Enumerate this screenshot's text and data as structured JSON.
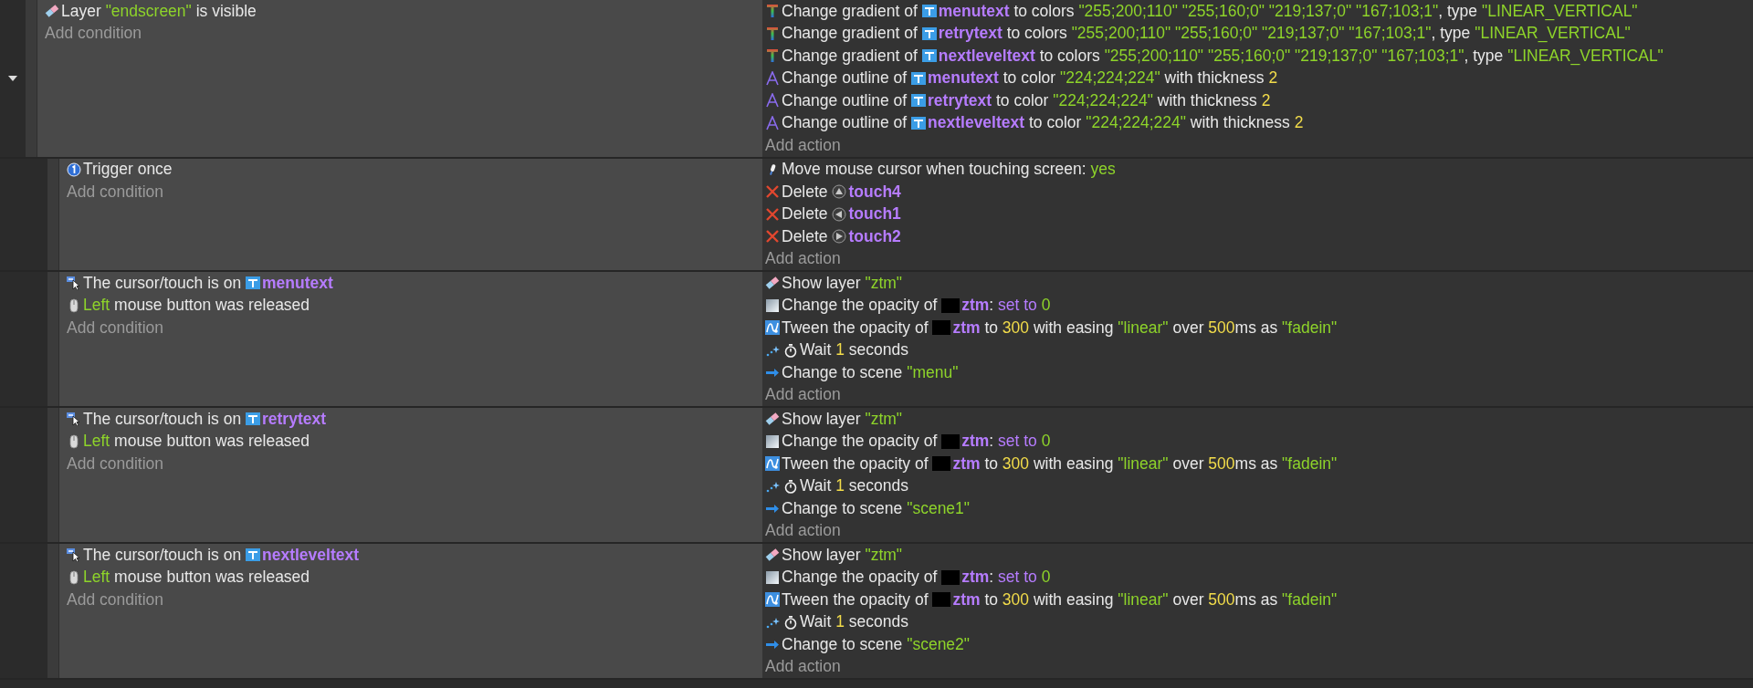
{
  "events": [
    {
      "expanded": true,
      "add_condition": "Add condition",
      "add_action": "Add action",
      "conditions": [
        {
          "kind": "layer",
          "parts": [
            {
              "kind": "plain",
              "text": "Layer "
            },
            {
              "kind": "string",
              "text": "\"endscreen\""
            },
            {
              "kind": "plain",
              "text": " is visible"
            }
          ]
        }
      ],
      "actions": [
        {
          "kind": "gradient",
          "parts": [
            {
              "kind": "plain",
              "text": "Change gradient of "
            },
            {
              "kind": "text-object",
              "text": "menutext"
            },
            {
              "kind": "plain",
              "text": " to colors "
            },
            {
              "kind": "string",
              "text": "\"255;200;110\" \"255;160;0\" \"219;137;0\" \"167;103;1\""
            },
            {
              "kind": "plain",
              "text": ", type "
            },
            {
              "kind": "string",
              "text": "\"LINEAR_VERTICAL\""
            }
          ]
        },
        {
          "kind": "gradient",
          "parts": [
            {
              "kind": "plain",
              "text": "Change gradient of "
            },
            {
              "kind": "text-object",
              "text": "retrytext"
            },
            {
              "kind": "plain",
              "text": " to colors "
            },
            {
              "kind": "string",
              "text": "\"255;200;110\" \"255;160;0\" \"219;137;0\" \"167;103;1\""
            },
            {
              "kind": "plain",
              "text": ", type "
            },
            {
              "kind": "string",
              "text": "\"LINEAR_VERTICAL\""
            }
          ]
        },
        {
          "kind": "gradient",
          "parts": [
            {
              "kind": "plain",
              "text": "Change gradient of "
            },
            {
              "kind": "text-object",
              "text": "nextleveltext"
            },
            {
              "kind": "plain",
              "text": " to colors "
            },
            {
              "kind": "string",
              "text": "\"255;200;110\" \"255;160;0\" \"219;137;0\" \"167;103;1\""
            },
            {
              "kind": "plain",
              "text": ", type "
            },
            {
              "kind": "string",
              "text": "\"LINEAR_VERTICAL\""
            }
          ]
        },
        {
          "kind": "outline",
          "parts": [
            {
              "kind": "plain",
              "text": "Change outline of "
            },
            {
              "kind": "text-object",
              "text": "menutext"
            },
            {
              "kind": "plain",
              "text": " to color "
            },
            {
              "kind": "string",
              "text": "\"224;224;224\""
            },
            {
              "kind": "plain",
              "text": " with thickness "
            },
            {
              "kind": "number",
              "text": "2"
            }
          ]
        },
        {
          "kind": "outline",
          "parts": [
            {
              "kind": "plain",
              "text": "Change outline of "
            },
            {
              "kind": "text-object",
              "text": "retrytext"
            },
            {
              "kind": "plain",
              "text": " to color "
            },
            {
              "kind": "string",
              "text": "\"224;224;224\""
            },
            {
              "kind": "plain",
              "text": " with thickness "
            },
            {
              "kind": "number",
              "text": "2"
            }
          ]
        },
        {
          "kind": "outline",
          "parts": [
            {
              "kind": "plain",
              "text": "Change outline of "
            },
            {
              "kind": "text-object",
              "text": "nextleveltext"
            },
            {
              "kind": "plain",
              "text": " to color "
            },
            {
              "kind": "string",
              "text": "\"224;224;224\""
            },
            {
              "kind": "plain",
              "text": " with thickness "
            },
            {
              "kind": "number",
              "text": "2"
            }
          ]
        }
      ],
      "children": [
        {
          "add_condition": "Add condition",
          "add_action": "Add action",
          "conditions": [
            {
              "kind": "trigger",
              "parts": [
                {
                  "kind": "plain",
                  "text": "Trigger once"
                }
              ]
            }
          ],
          "actions": [
            {
              "kind": "touch",
              "parts": [
                {
                  "kind": "plain",
                  "text": "Move mouse cursor when touching screen: "
                },
                {
                  "kind": "string",
                  "text": "yes"
                }
              ]
            },
            {
              "kind": "delete",
              "parts": [
                {
                  "kind": "plain",
                  "text": "Delete "
                },
                {
                  "kind": "up-button",
                  "text": "touch4"
                }
              ]
            },
            {
              "kind": "delete",
              "parts": [
                {
                  "kind": "plain",
                  "text": "Delete "
                },
                {
                  "kind": "left-button",
                  "text": "touch1"
                }
              ]
            },
            {
              "kind": "delete",
              "parts": [
                {
                  "kind": "plain",
                  "text": "Delete "
                },
                {
                  "kind": "right-button",
                  "text": "touch2"
                }
              ]
            }
          ]
        },
        {
          "add_condition": "Add condition",
          "add_action": "Add action",
          "conditions": [
            {
              "kind": "cursor",
              "parts": [
                {
                  "kind": "plain",
                  "text": "The cursor/touch is on "
                },
                {
                  "kind": "text-object",
                  "text": "menutext"
                }
              ]
            },
            {
              "kind": "mouse",
              "parts": [
                {
                  "kind": "string",
                  "text": "Left"
                },
                {
                  "kind": "plain",
                  "text": " mouse button was released"
                }
              ]
            }
          ],
          "actions": [
            {
              "kind": "layer",
              "parts": [
                {
                  "kind": "plain",
                  "text": "Show layer "
                },
                {
                  "kind": "string",
                  "text": "\"ztm\""
                }
              ]
            },
            {
              "kind": "opacity",
              "parts": [
                {
                  "kind": "plain",
                  "text": "Change the opacity of "
                },
                {
                  "kind": "sprite-object",
                  "text": "ztm"
                },
                {
                  "kind": "plain",
                  "text": ": "
                },
                {
                  "kind": "param",
                  "text": "set to "
                },
                {
                  "kind": "string",
                  "text": "0"
                }
              ]
            },
            {
              "kind": "tween",
              "parts": [
                {
                  "kind": "plain",
                  "text": "Tween the opacity of "
                },
                {
                  "kind": "sprite-object",
                  "text": "ztm"
                },
                {
                  "kind": "plain",
                  "text": " to "
                },
                {
                  "kind": "number",
                  "text": "300"
                },
                {
                  "kind": "plain",
                  "text": " with easing "
                },
                {
                  "kind": "string",
                  "text": "\"linear\""
                },
                {
                  "kind": "plain",
                  "text": " over "
                },
                {
                  "kind": "number",
                  "text": "500"
                },
                {
                  "kind": "plain",
                  "text": "ms as "
                },
                {
                  "kind": "string",
                  "text": "\"fadein\""
                }
              ]
            },
            {
              "kind": "wait",
              "parts": [
                {
                  "kind": "plain",
                  "text": "Wait "
                },
                {
                  "kind": "number",
                  "text": "1"
                },
                {
                  "kind": "plain",
                  "text": " seconds"
                }
              ]
            },
            {
              "kind": "scene",
              "parts": [
                {
                  "kind": "plain",
                  "text": "Change to scene "
                },
                {
                  "kind": "string",
                  "text": "\"menu\""
                }
              ]
            }
          ]
        },
        {
          "add_condition": "Add condition",
          "add_action": "Add action",
          "conditions": [
            {
              "kind": "cursor",
              "parts": [
                {
                  "kind": "plain",
                  "text": "The cursor/touch is on "
                },
                {
                  "kind": "text-object",
                  "text": "retrytext"
                }
              ]
            },
            {
              "kind": "mouse",
              "parts": [
                {
                  "kind": "string",
                  "text": "Left"
                },
                {
                  "kind": "plain",
                  "text": " mouse button was released"
                }
              ]
            }
          ],
          "actions": [
            {
              "kind": "layer",
              "parts": [
                {
                  "kind": "plain",
                  "text": "Show layer "
                },
                {
                  "kind": "string",
                  "text": "\"ztm\""
                }
              ]
            },
            {
              "kind": "opacity",
              "parts": [
                {
                  "kind": "plain",
                  "text": "Change the opacity of "
                },
                {
                  "kind": "sprite-object",
                  "text": "ztm"
                },
                {
                  "kind": "plain",
                  "text": ": "
                },
                {
                  "kind": "param",
                  "text": "set to "
                },
                {
                  "kind": "string",
                  "text": "0"
                }
              ]
            },
            {
              "kind": "tween",
              "parts": [
                {
                  "kind": "plain",
                  "text": "Tween the opacity of "
                },
                {
                  "kind": "sprite-object",
                  "text": "ztm"
                },
                {
                  "kind": "plain",
                  "text": " to "
                },
                {
                  "kind": "number",
                  "text": "300"
                },
                {
                  "kind": "plain",
                  "text": " with easing "
                },
                {
                  "kind": "string",
                  "text": "\"linear\""
                },
                {
                  "kind": "plain",
                  "text": " over "
                },
                {
                  "kind": "number",
                  "text": "500"
                },
                {
                  "kind": "plain",
                  "text": "ms as "
                },
                {
                  "kind": "string",
                  "text": "\"fadein\""
                }
              ]
            },
            {
              "kind": "wait",
              "parts": [
                {
                  "kind": "plain",
                  "text": "Wait "
                },
                {
                  "kind": "number",
                  "text": "1"
                },
                {
                  "kind": "plain",
                  "text": " seconds"
                }
              ]
            },
            {
              "kind": "scene",
              "parts": [
                {
                  "kind": "plain",
                  "text": "Change to scene "
                },
                {
                  "kind": "string",
                  "text": "\"scene1\""
                }
              ]
            }
          ]
        },
        {
          "add_condition": "Add condition",
          "add_action": "Add action",
          "conditions": [
            {
              "kind": "cursor",
              "parts": [
                {
                  "kind": "plain",
                  "text": "The cursor/touch is on "
                },
                {
                  "kind": "text-object",
                  "text": "nextleveltext"
                }
              ]
            },
            {
              "kind": "mouse",
              "parts": [
                {
                  "kind": "string",
                  "text": "Left"
                },
                {
                  "kind": "plain",
                  "text": " mouse button was released"
                }
              ]
            }
          ],
          "actions": [
            {
              "kind": "layer",
              "parts": [
                {
                  "kind": "plain",
                  "text": "Show layer "
                },
                {
                  "kind": "string",
                  "text": "\"ztm\""
                }
              ]
            },
            {
              "kind": "opacity",
              "parts": [
                {
                  "kind": "plain",
                  "text": "Change the opacity of "
                },
                {
                  "kind": "sprite-object",
                  "text": "ztm"
                },
                {
                  "kind": "plain",
                  "text": ": "
                },
                {
                  "kind": "param",
                  "text": "set to "
                },
                {
                  "kind": "string",
                  "text": "0"
                }
              ]
            },
            {
              "kind": "tween",
              "parts": [
                {
                  "kind": "plain",
                  "text": "Tween the opacity of "
                },
                {
                  "kind": "sprite-object",
                  "text": "ztm"
                },
                {
                  "kind": "plain",
                  "text": " to "
                },
                {
                  "kind": "number",
                  "text": "300"
                },
                {
                  "kind": "plain",
                  "text": " with easing "
                },
                {
                  "kind": "string",
                  "text": "\"linear\""
                },
                {
                  "kind": "plain",
                  "text": " over "
                },
                {
                  "kind": "number",
                  "text": "500"
                },
                {
                  "kind": "plain",
                  "text": "ms as "
                },
                {
                  "kind": "string",
                  "text": "\"fadein\""
                }
              ]
            },
            {
              "kind": "wait",
              "parts": [
                {
                  "kind": "plain",
                  "text": "Wait "
                },
                {
                  "kind": "number",
                  "text": "1"
                },
                {
                  "kind": "plain",
                  "text": " seconds"
                }
              ]
            },
            {
              "kind": "scene",
              "parts": [
                {
                  "kind": "plain",
                  "text": "Change to scene "
                },
                {
                  "kind": "string",
                  "text": "\"scene2\""
                }
              ]
            }
          ]
        }
      ]
    }
  ]
}
